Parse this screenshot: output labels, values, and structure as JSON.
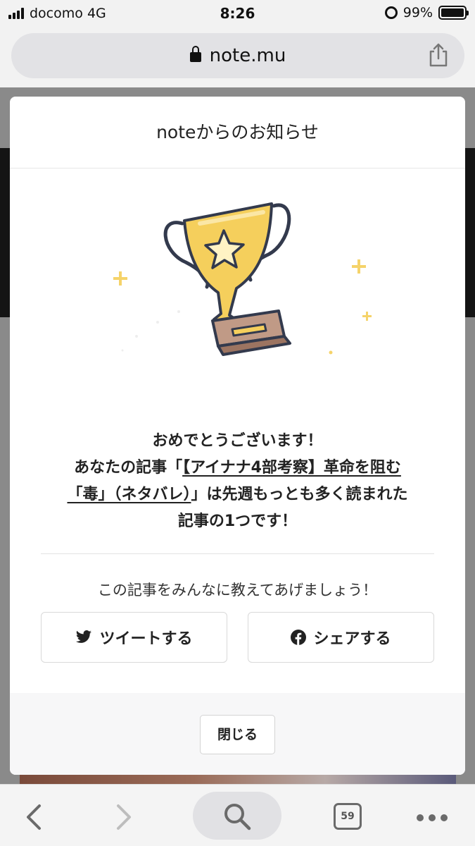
{
  "status_bar": {
    "carrier": "docomo",
    "network": "4G",
    "time": "8:26",
    "battery": "99%"
  },
  "browser": {
    "url": "note.mu",
    "tab_count": "59"
  },
  "modal": {
    "title": "noteからのお知らせ",
    "message": {
      "line1": "おめでとうございます！",
      "line2_prefix": "あなたの記事「",
      "article_title_part1": "【アイナナ4部考察】革命を阻む",
      "article_title_part2": "「毒」（ネタバレ）",
      "line3_suffix": "」は先週もっとも多く読まれた",
      "line4": "記事の1つです！"
    },
    "share_prompt": "この記事をみんなに教えてあげましょう！",
    "tweet_label": "ツイートする",
    "facebook_label": "シェアする",
    "close_label": "閉じる"
  },
  "colors": {
    "trophy_gold": "#f5cf5c",
    "sparkle": "#f5d36a",
    "outline": "#333a4d",
    "base_brown": "#b08470"
  }
}
